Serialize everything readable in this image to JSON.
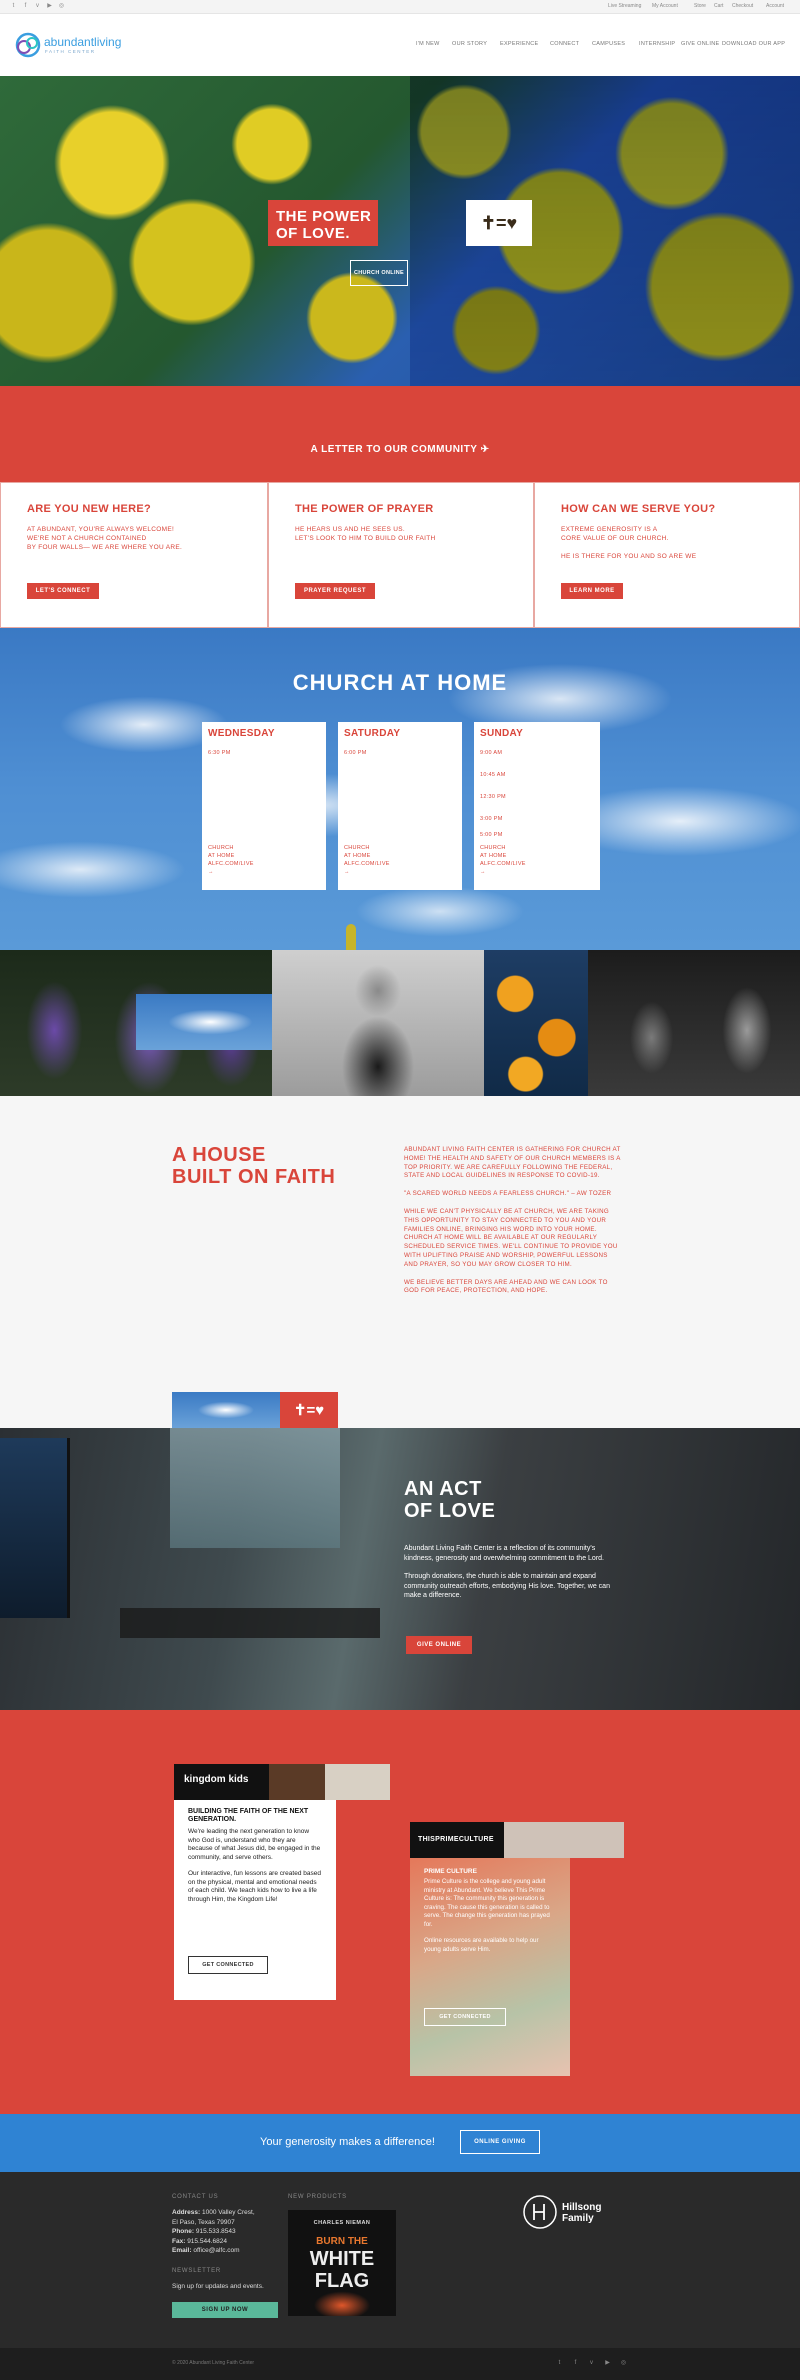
{
  "topbar": {
    "social_icons": [
      "twitter-icon",
      "facebook-icon",
      "vimeo-icon",
      "youtube-icon",
      "instagram-icon"
    ],
    "links": [
      "Live Streaming",
      "My Account",
      "Store",
      "Cart",
      "Checkout",
      "Account"
    ]
  },
  "header": {
    "logo_text": "abundantliving",
    "logo_sub": "FAITH CENTER",
    "nav": [
      "I'M NEW",
      "OUR STORY",
      "EXPERIENCE",
      "CONNECT",
      "CAMPUSES",
      "INTERNSHIP",
      "GIVE ONLINE",
      "DOWNLOAD OUR APP"
    ]
  },
  "hero": {
    "title_line1": "THE POWER",
    "title_line2": "OF LOVE.",
    "equation": "✝=♥",
    "button": "CHURCH ONLINE"
  },
  "letter": {
    "label": "A LETTER TO OUR COMMUNITY ✈"
  },
  "boxes": [
    {
      "title": "ARE YOU NEW HERE?",
      "lines": [
        "AT ABUNDANT, YOU'RE ALWAYS WELCOME!",
        "WE'RE NOT A CHURCH CONTAINED",
        "BY FOUR WALLS— WE ARE WHERE YOU ARE."
      ],
      "button": "LET'S CONNECT"
    },
    {
      "title": "THE POWER OF PRAYER",
      "lines": [
        "HE HEARS US AND HE SEES US.",
        "LET'S LOOK TO HIM TO BUILD OUR FAITH"
      ],
      "button": "PRAYER REQUEST"
    },
    {
      "title": "HOW CAN WE SERVE YOU?",
      "lines": [
        "EXTREME GENEROSITY IS A",
        "CORE VALUE OF OUR CHURCH.",
        "",
        "HE IS THERE FOR YOU AND SO ARE WE"
      ],
      "button": "LEARN MORE"
    }
  ],
  "church_at_home": {
    "title": "CHURCH AT HOME",
    "days": [
      {
        "name": "WEDNESDAY",
        "times": [
          "6:30 PM"
        ],
        "loc": [
          "CHURCH",
          "AT HOME",
          "ALFC.COM/LIVE",
          "→"
        ]
      },
      {
        "name": "SATURDAY",
        "times": [
          "6:00 PM"
        ],
        "loc": [
          "CHURCH",
          "AT HOME",
          "ALFC.COM/LIVE",
          "→"
        ]
      },
      {
        "name": "SUNDAY",
        "times": [
          "9:00 AM",
          "10:45 AM",
          "12:30 PM",
          "3:00 PM",
          "5:00 PM"
        ],
        "loc": [
          "CHURCH",
          "AT HOME",
          "ALFC.COM/LIVE",
          "→"
        ]
      }
    ]
  },
  "faith": {
    "title_line1": "A HOUSE",
    "title_line2": "BUILT ON FAITH",
    "paragraphs": [
      "ABUNDANT LIVING FAITH CENTER IS GATHERING FOR CHURCH AT HOME! THE HEALTH AND SAFETY OF OUR CHURCH MEMBERS IS A TOP PRIORITY. WE ARE CAREFULLY FOLLOWING THE FEDERAL, STATE AND LOCAL GUIDELINES IN RESPONSE TO COVID-19.",
      "\"A SCARED WORLD NEEDS A FEARLESS CHURCH.\" – AW TOZER",
      "WHILE WE CAN'T PHYSICALLY BE AT CHURCH, WE ARE TAKING THIS OPPORTUNITY TO STAY CONNECTED TO YOU AND YOUR FAMILIES ONLINE, BRINGING HIS WORD INTO YOUR HOME. CHURCH AT HOME WILL BE AVAILABLE AT OUR REGULARLY SCHEDULED SERVICE TIMES. WE'LL CONTINUE TO PROVIDE YOU WITH UPLIFTING PRAISE AND WORSHIP, POWERFUL LESSONS AND PRAYER, SO YOU MAY GROW CLOSER TO HIM.",
      "WE BELIEVE BETTER DAYS ARE AHEAD AND WE CAN LOOK TO GOD FOR PEACE, PROTECTION, AND HOPE."
    ],
    "badge": "✝=♥"
  },
  "act": {
    "title_line1": "AN ACT",
    "title_line2": "OF LOVE",
    "paragraphs": [
      "Abundant Living Faith Center is a reflection of its community's kindness, generosity and overwhelming commitment to the Lord.",
      "Through donations, the church is able to maintain and expand community outreach efforts, embodying His love. Together, we can make a difference."
    ],
    "button": "GIVE ONLINE"
  },
  "kids": {
    "logo": "kingdom kids",
    "heading": "BUILDING THE FAITH OF THE NEXT GENERATION.",
    "p1": "We're leading the next generation to know who God is, understand who they are because of what Jesus did, be engaged in the community, and serve others.",
    "p2": "Our interactive, fun lessons are created based on the physical, mental and emotional needs of each child. We teach kids how to live a life through Him, the Kingdom Life!",
    "button": "GET CONNECTED"
  },
  "prime": {
    "logo": "THISPRIMECULTURE",
    "heading": "PRIME CULTURE",
    "p1": "Prime Culture is the college and young adult ministry at Abundant. We believe This Prime Culture is: The community this generation is craving. The cause this generation is called to serve. The change this generation has prayed for.",
    "p2": "Online resources are available to help our young adults serve Him.",
    "button": "GET CONNECTED"
  },
  "giving": {
    "text": "Your generosity makes a difference!",
    "button": "ONLINE GIVING"
  },
  "footer": {
    "contact_heading": "CONTACT US",
    "address_label": "Address:",
    "address": "1000 Valley Crest,",
    "city": "El Paso, Texas 79907",
    "phone_label": "Phone:",
    "phone": "915.533.8543",
    "fax_label": "Fax:",
    "fax": "915.544.6824",
    "email_label": "Email:",
    "email": "office@alfc.com",
    "newsletter_heading": "NEWSLETTER",
    "newsletter_text": "Sign up for updates and events.",
    "signup_button": "SIGN UP NOW",
    "products_heading": "NEW PRODUCTS",
    "book_author": "CHARLES NIEMAN",
    "book_title1": "BURN THE",
    "book_title2": "WHITE",
    "book_title3": "FLAG",
    "partner_logo": "Hillsong Family",
    "copyright": "© 2020 Abundant Living Faith Center",
    "social_icons": [
      "twitter-icon",
      "facebook-icon",
      "vimeo-icon",
      "youtube-icon",
      "instagram-icon"
    ]
  },
  "colors": {
    "accent": "#d9453a",
    "blue": "#2f83d3",
    "dark": "#2a2a2a"
  }
}
